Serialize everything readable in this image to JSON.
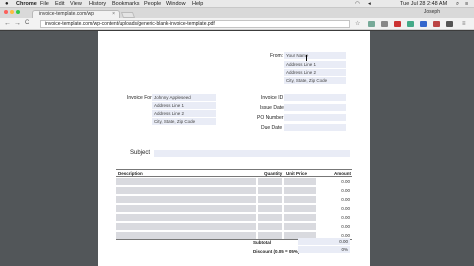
{
  "menubar": {
    "app": "Chrome",
    "items": [
      "File",
      "Edit",
      "View",
      "History",
      "Bookmarks",
      "People",
      "Window",
      "Help"
    ],
    "clock": "Tue Jul 28  2:48 AM",
    "user": "Joseph"
  },
  "tab": {
    "title": "invoice-template.com/wp",
    "close": "×"
  },
  "toolbar": {
    "back": "←",
    "forward": "→",
    "reload": "C",
    "url": "invoice-template.com/wp-content/uploads/generic-blank-invoice-template.pdf",
    "star": "☆",
    "menu": "≡"
  },
  "invoice": {
    "from_label": "From:",
    "from_fields": [
      "Your Name",
      "Address Line 1",
      "Address Line 2",
      "City, State, Zip Code"
    ],
    "invoice_for_label": "Invoice For:",
    "for_fields": [
      "Johnny Appleseed",
      "Address Line 1",
      "Address Line 2",
      "City, State, Zip Code"
    ],
    "meta_labels": [
      "Invoice ID",
      "Issue Date",
      "PO Number",
      "Due Date"
    ],
    "subject_label": "Subject",
    "table": {
      "headers": [
        "Description",
        "Quantity",
        "Unit Price",
        "Amount"
      ],
      "amounts": [
        "0.00",
        "0.00",
        "0.00",
        "0.00",
        "0.00",
        "0.00",
        "0.00"
      ]
    },
    "subtotal_label": "Subtotal",
    "subtotal_value": "0.00",
    "discount_label": "Discount (0.05 = 05%)",
    "discount_value": "0%"
  },
  "colors": {
    "field_bg": "#e9ecf6",
    "cell_bg": "#d9dadf",
    "viewer_bg": "#525659"
  }
}
